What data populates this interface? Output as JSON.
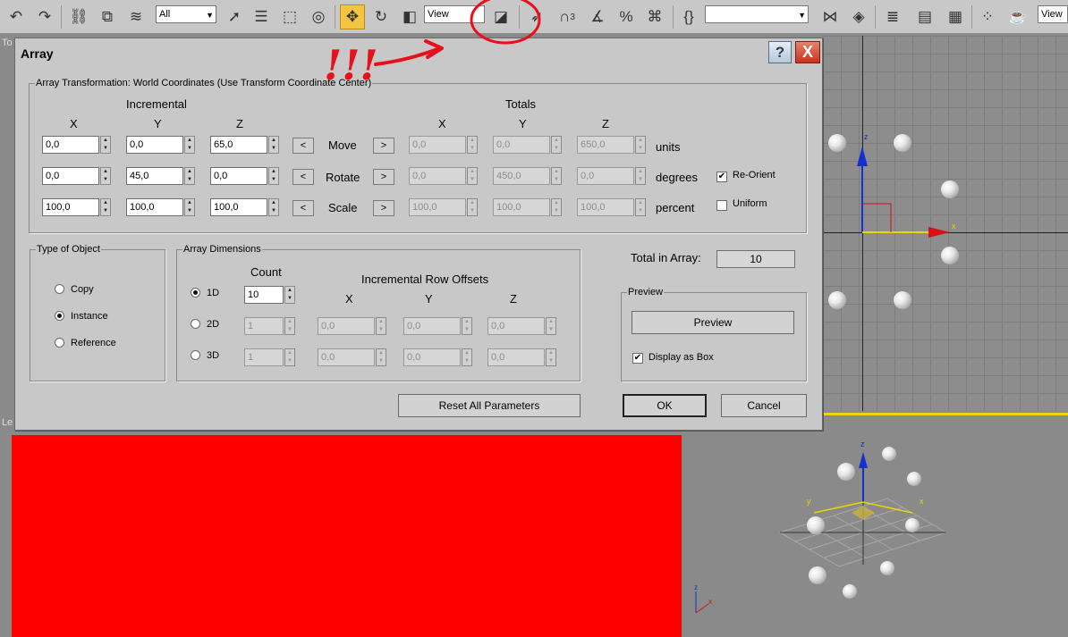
{
  "toolbar": {
    "selection_filter": "All",
    "ref_coord_system": "View",
    "ref_coord_system_right": "View",
    "snap_angle_label": "3",
    "named_selection": ""
  },
  "viewports": {
    "top_label": "To",
    "left_label": "Le"
  },
  "dialog": {
    "title": "Array",
    "help_label": "?",
    "close_label": "X",
    "transform": {
      "legend": "Array Transformation: World Coordinates (Use Transform Coordinate Center)",
      "incremental_label": "Incremental",
      "totals_label": "Totals",
      "axis_x": "X",
      "axis_y": "Y",
      "axis_z": "Z",
      "left_arrow": "<",
      "right_arrow": ">",
      "rows": [
        {
          "label": "Move",
          "unit": "units",
          "inc": [
            "0,0",
            "0,0",
            "65,0"
          ],
          "tot": [
            "0,0",
            "0,0",
            "650,0"
          ]
        },
        {
          "label": "Rotate",
          "unit": "degrees",
          "inc": [
            "0,0",
            "45,0",
            "0,0"
          ],
          "tot": [
            "0,0",
            "450,0",
            "0,0"
          ]
        },
        {
          "label": "Scale",
          "unit": "percent",
          "inc": [
            "100,0",
            "100,0",
            "100,0"
          ],
          "tot": [
            "100,0",
            "100,0",
            "100,0"
          ]
        }
      ],
      "reorient_label": "Re-Orient",
      "reorient_checked": true,
      "uniform_label": "Uniform",
      "uniform_checked": false
    },
    "type_of_object": {
      "legend": "Type of Object",
      "options": [
        "Copy",
        "Instance",
        "Reference"
      ],
      "selected": "Instance"
    },
    "array_dimensions": {
      "legend": "Array Dimensions",
      "count_label": "Count",
      "offsets_label": "Incremental Row Offsets",
      "axis_x": "X",
      "axis_y": "Y",
      "axis_z": "Z",
      "rows": [
        {
          "label": "1D",
          "count": "10",
          "offsets": []
        },
        {
          "label": "2D",
          "count": "1",
          "offsets": [
            "0,0",
            "0,0",
            "0,0"
          ]
        },
        {
          "label": "3D",
          "count": "1",
          "offsets": [
            "0,0",
            "0,0",
            "0,0"
          ]
        }
      ],
      "selected": "1D"
    },
    "total_in_array_label": "Total in Array:",
    "total_in_array": "10",
    "preview": {
      "legend": "Preview",
      "button": "Preview",
      "display_as_box_label": "Display as Box",
      "display_as_box_checked": true
    },
    "reset_button": "Reset All Parameters",
    "ok_button": "OK",
    "cancel_button": "Cancel"
  },
  "annotation": {
    "text": "!!!",
    "color": "#e8101a"
  },
  "colors": {
    "dialog_bg": "#c8c8c8",
    "red_block": "#ff0000",
    "viewport_bg": "#8a8a8a",
    "active_viewport_border": "#f2d21a"
  }
}
